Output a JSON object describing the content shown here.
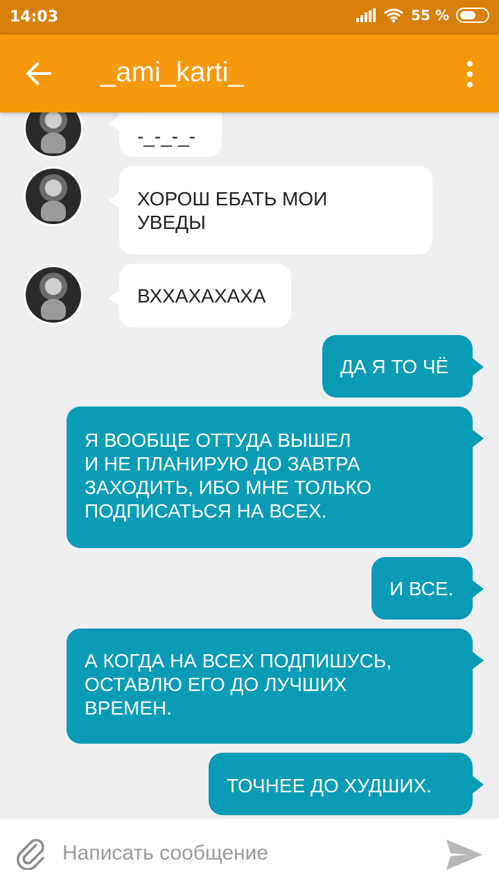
{
  "status": {
    "time": "14:03",
    "battery": "55 %"
  },
  "header": {
    "title": "_ami_karti_"
  },
  "messages": {
    "m0": {
      "line1": "-_-_-_-"
    },
    "m1": {
      "line1": "ХОРОШ ЕБАТЬ МОИ",
      "line2": "УВЕДЫ"
    },
    "m2": {
      "line1": "ВХХАХАХАХА"
    },
    "m3": {
      "line1": "ДА Я ТО ЧЁ"
    },
    "m4": {
      "line1": "Я ВООБЩЕ ОТТУДА ВЫШЕЛ",
      "line2": "И НЕ ПЛАНИРУЮ ДО ЗАВТРА",
      "line3": "ЗАХОДИТЬ, ИБО МНЕ ТОЛЬКО",
      "line4": "ПОДПИСАТЬСЯ НА ВСЕХ."
    },
    "m5": {
      "line1": "И ВСЕ."
    },
    "m6": {
      "line1": "А КОГДА НА ВСЕХ ПОДПИШУСЬ,",
      "line2": "ОСТАВЛЮ ЕГО ДО ЛУЧШИХ",
      "line3": "ВРЕМЕН."
    },
    "m7": {
      "line1": "ТОЧНЕЕ ДО ХУДШИХ."
    }
  },
  "composer": {
    "placeholder": "Написать сообщение"
  },
  "icons": {
    "back": "arrow-left-icon",
    "menu": "more-vertical-icon",
    "attach": "paperclip-icon",
    "send": "send-icon"
  },
  "colors": {
    "app_bar": "#f7990d",
    "status_bar": "#d87f0a",
    "outgoing_bubble": "#0a9cb6",
    "incoming_bubble": "#ffffff",
    "chat_background": "#efeef1"
  }
}
